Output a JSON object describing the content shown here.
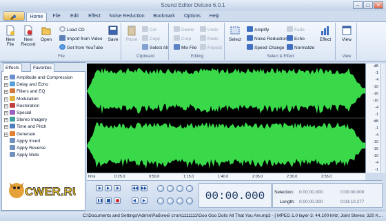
{
  "window": {
    "title": "Sound Editor Deluxe 6.0.1"
  },
  "tabs": [
    {
      "label": "Home",
      "active": true
    },
    {
      "label": "File"
    },
    {
      "label": "Edit"
    },
    {
      "label": "Effect"
    },
    {
      "label": "Noise Reduction"
    },
    {
      "label": "Bookmark"
    },
    {
      "label": "Options"
    },
    {
      "label": "Help"
    }
  ],
  "ribbon": {
    "file_group": {
      "label": "File",
      "new_file": "New\nFile",
      "new_record": "New\nRecord",
      "open": "Open",
      "load_cd": "Load CD",
      "import_video": "Import from Video",
      "get_youtube": "Get from YouTube",
      "save": "Save"
    },
    "clipboard_group": {
      "label": "Clipboard",
      "paste": "Paste",
      "cut": "Cut",
      "copy": "Copy",
      "select_all": "Select All"
    },
    "editing_group": {
      "label": "Editing",
      "delete": "Delete",
      "crop": "Crop",
      "mix_file": "Mix File",
      "undo": "Undo",
      "redo": "Redo",
      "repeat": "Repeat"
    },
    "select_effect_group": {
      "label": "Select & Effect",
      "select": "Select",
      "amplify": "Amplify",
      "noise_reduction": "Noise Reduction",
      "speed_change": "Speed Change",
      "fade": "Fade",
      "echo": "Echo",
      "normalize": "Normalize",
      "effect": "Effect"
    },
    "view_group": {
      "label": "View",
      "view": "View"
    }
  },
  "left_panel": {
    "tabs": [
      "Effects",
      "Favorites"
    ],
    "tree": [
      {
        "label": "Amplitude and Compression",
        "expandable": true,
        "color": "#6a8fd0"
      },
      {
        "label": "Delay and Echo",
        "expandable": true,
        "color": "#5aa0d8"
      },
      {
        "label": "Filters and EQ",
        "expandable": true,
        "color": "#d07a3a"
      },
      {
        "label": "Modulation",
        "expandable": true,
        "color": "#e0b040"
      },
      {
        "label": "Restoration",
        "expandable": true,
        "color": "#c04040"
      },
      {
        "label": "Special",
        "expandable": true,
        "color": "#9a60c0"
      },
      {
        "label": "Stereo Imagery",
        "expandable": true,
        "color": "#40a0a0"
      },
      {
        "label": "Time and Pitch",
        "expandable": true,
        "color": "#5080c0"
      },
      {
        "label": "Generate",
        "expandable": true,
        "color": "#e08030"
      },
      {
        "label": "Apply Invert",
        "expandable": false,
        "color": "#7090c0"
      },
      {
        "label": "Apply Reverse",
        "expandable": false,
        "color": "#7090c0"
      },
      {
        "label": "Apply Mute",
        "expandable": false,
        "color": "#7090c0"
      }
    ],
    "logo_text": "CWER.RU"
  },
  "waveform": {
    "color": "#39d94a",
    "background": "#000000"
  },
  "db_scale": [
    "dB",
    "-1",
    "-4",
    "-10",
    "-16",
    "-10",
    "-4",
    "-1",
    "dB",
    "-1",
    "-4",
    "-10",
    "-16",
    "-10",
    "-4",
    "-1"
  ],
  "ruler": {
    "unit": "hms",
    "ticks": [
      "0:25.0",
      "0:50.0",
      "1:15.0",
      "1:40.0",
      "2:05.0",
      "2:30.0",
      "2:55.0"
    ]
  },
  "transport": {
    "time": "00:00.000"
  },
  "selection": {
    "selection_label": "Selection:",
    "length_label": "Length:",
    "sel_start": "0:00:00.000",
    "sel_end": "0:00:00.000",
    "len_start": "0:00:00.000",
    "len_end": "0:03:10.277"
  },
  "status": {
    "text": "C:\\Documents and Settings\\Admin\\Рабочий стол\\1111111\\Goo Goo Dolls All That You Are.mp3 - [ MPEG 1.0 layer-3: 44,100 kHz; Joint Stereo; 320 Kbps; ]"
  }
}
